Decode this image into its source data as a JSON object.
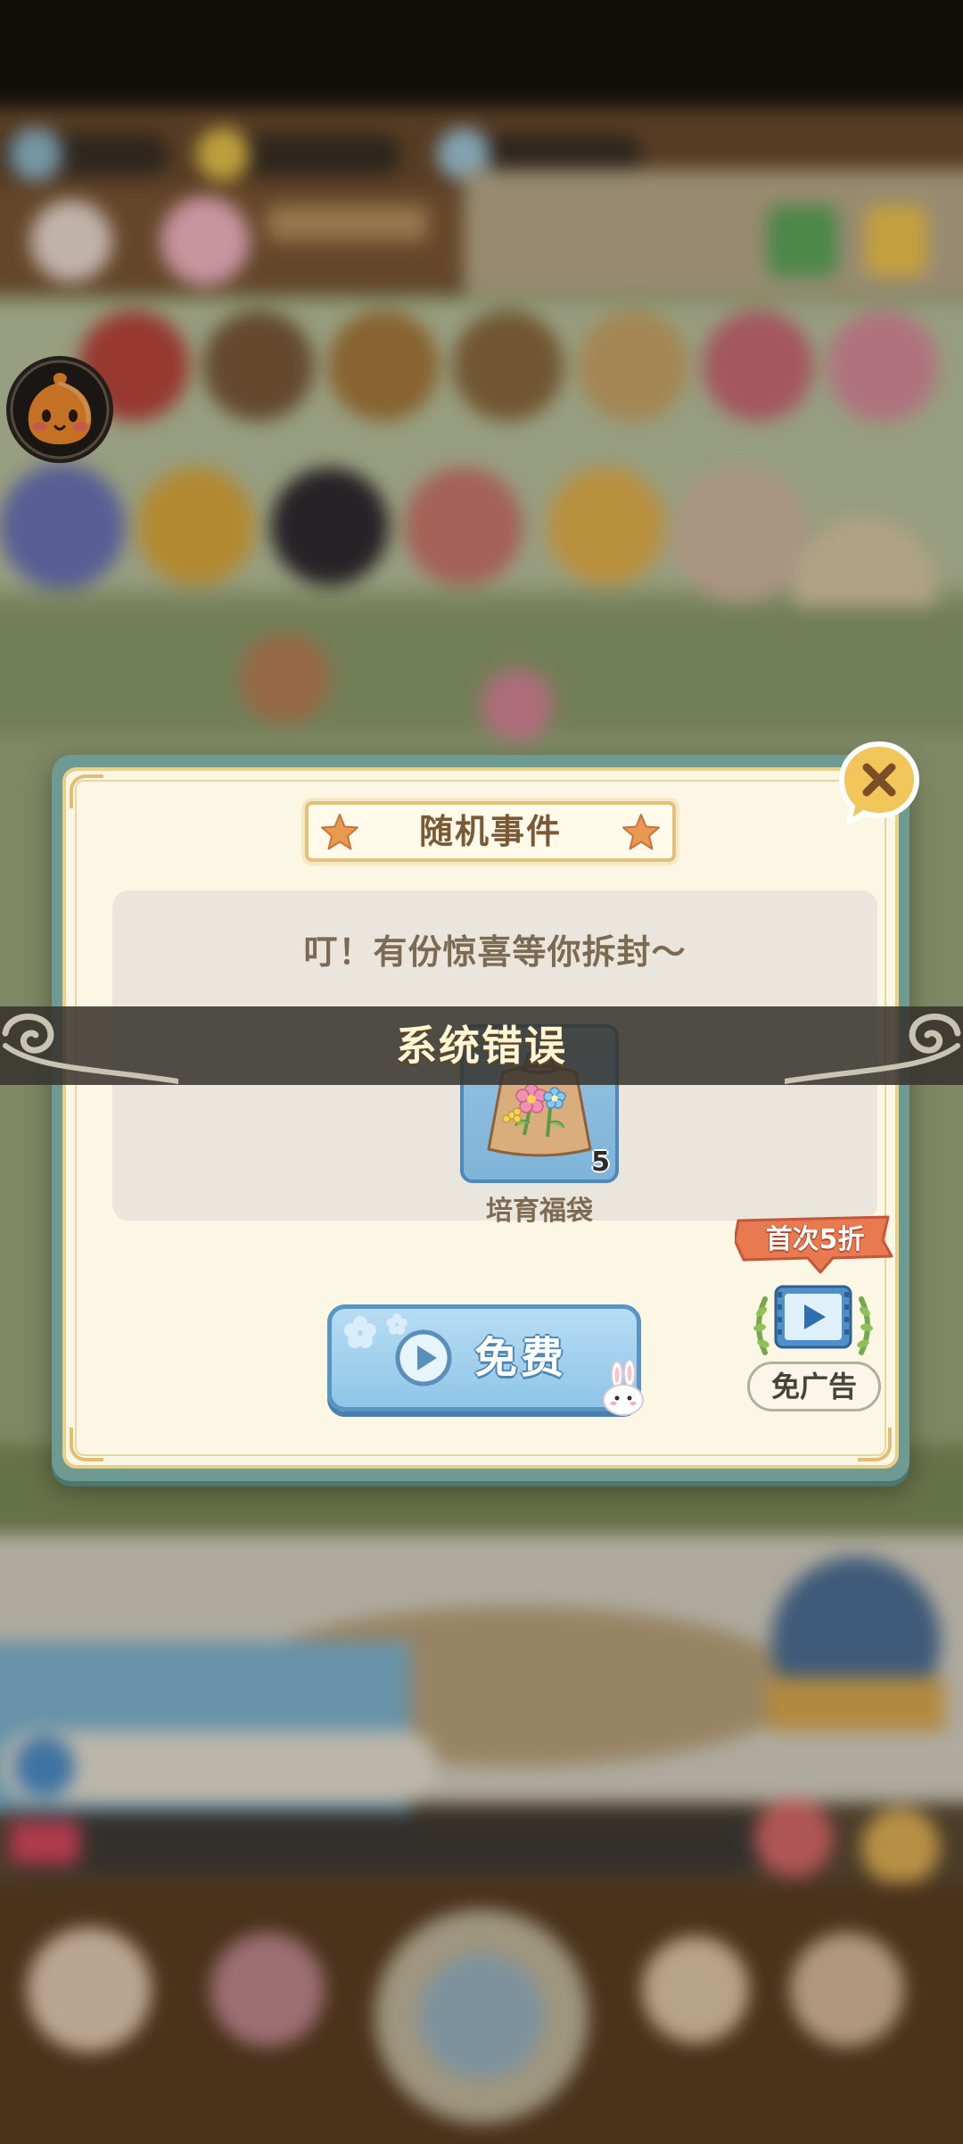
{
  "dialog": {
    "title": "随机事件",
    "message": "叮！有份惊喜等你拆封～",
    "reward": {
      "name": "培育福袋",
      "count": "5"
    },
    "free_button_label": "免费",
    "discount_tag": "首次5折",
    "ad_free_label": "免广告"
  },
  "toast": {
    "text": "系统错误"
  },
  "colors": {
    "dialog_frame": "#6f9a92",
    "dialog_paper": "#fcf7e4",
    "title_text": "#7a5a34",
    "panel": "#ebe6dd",
    "free_button": "#8fc5e8",
    "discount_tag": "#e9794f",
    "close_button": "#f2c65a",
    "toast_bg": "#36322c"
  },
  "icons": {
    "close": "close-icon",
    "title_decor": "star-icon",
    "reward": "flower-bag-icon",
    "play": "play-icon",
    "bunny": "bunny-icon",
    "video": "video-ad-icon",
    "avatar": "orange-slime-avatar-icon"
  }
}
